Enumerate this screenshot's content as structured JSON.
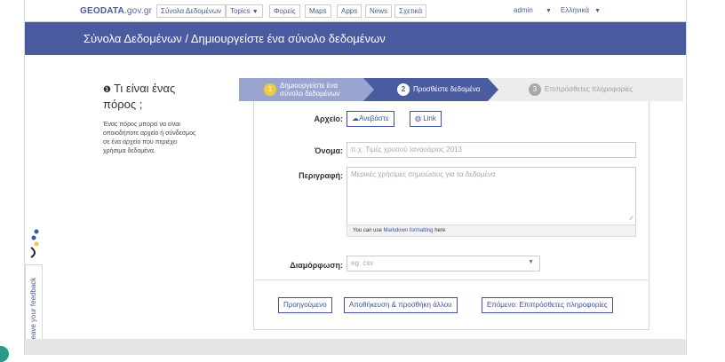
{
  "nav": {
    "brand": "GEODATA",
    "brand_suffix": ".gov.gr",
    "datasets": "Σύνολα Δεδομένων",
    "topics": "Topics",
    "agencies": "Φορείς",
    "maps": "Maps",
    "apps": "Apps",
    "news": "News",
    "about": "Σχετικά",
    "user": "admin",
    "language": "Ελληνικά"
  },
  "banner": {
    "title": "Σύνολα Δεδομένων / Δημιουργείστε ένα σύνολο δεδομένων"
  },
  "info": {
    "title": "Τι είναι ένας πόρος ;",
    "text": "Ένας πόρος μπορεί να είναι οποιοδήποτε αρχείο ή σύνδεσμος σε ένα αρχείο που περιέχει χρήσιμα δεδομένα."
  },
  "stages": [
    {
      "num": "1",
      "label_line1": "Δημιουργείστε ένα",
      "label_line2": "σύνολο δεδομένων"
    },
    {
      "num": "2",
      "label": "Προσθέστε δεδομένα"
    },
    {
      "num": "3",
      "label": "Επιπρόσθετες πληροφορίες"
    }
  ],
  "form": {
    "file_label": "Αρχείο:",
    "upload_button": "Ανεβάστε",
    "link_button": "Link",
    "name_label": "Όνομα:",
    "name_placeholder": "π.χ. Τιμές χρυσού Ιανουάριος 2013",
    "desc_label": "Περιγραφή:",
    "desc_placeholder": "Μερικές χρήσιμες σημειώσεις για τα δεδομένα",
    "hint_prefix": "You can use",
    "hint_link": "Markdown formatting",
    "hint_suffix": "here",
    "format_label": "Διαμόρφωση:",
    "format_placeholder": "eg. csv"
  },
  "actions": {
    "previous": "Προηγούμενο",
    "save_add": "Αποθήκευση & προσθήκη άλλου",
    "next": "Επόμενο: Επιπρόσθετες πληροφορίες"
  },
  "feedback": {
    "label": "Leave your feedback"
  }
}
